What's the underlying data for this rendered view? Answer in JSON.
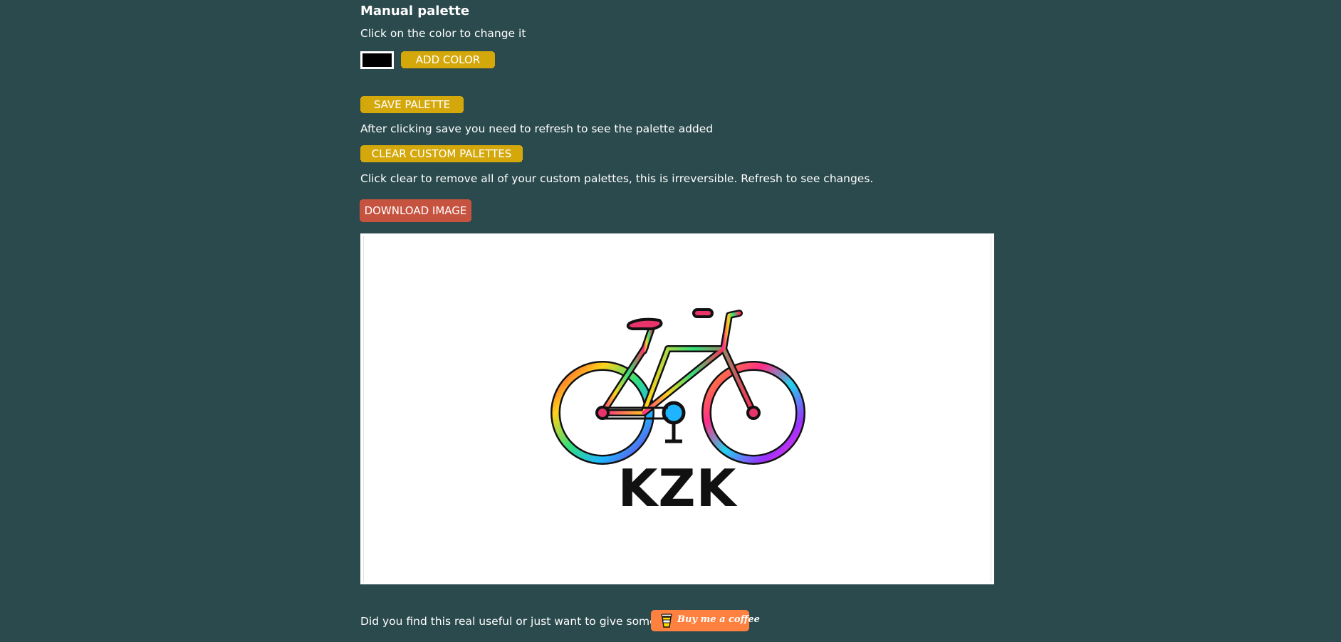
{
  "manual_palette": {
    "heading": "Manual palette",
    "hint": "Click on the color to change it",
    "swatch_color": "#000000",
    "add_color_label": "ADD COLOR"
  },
  "save": {
    "button_label": "SAVE PALETTE",
    "note": "After clicking save you need to refresh to see the palette added"
  },
  "clear": {
    "button_label": "CLEAR CUSTOM PALETTES",
    "note": "Click clear to remove all of your custom palettes, this is irreversible. Refresh to see changes."
  },
  "download": {
    "button_label": "DOWNLOAD IMAGE"
  },
  "preview": {
    "logo_text": "KZK",
    "image_subject": "rainbow bicycle"
  },
  "footer": {
    "tip_text": "Did you find this real useful or just want to give some tip?",
    "coffee_label": "Buy me a coffee"
  },
  "colors": {
    "background": "#2b4a4d",
    "button_yellow": "#d4a80b",
    "button_red": "#c65340",
    "coffee_orange": "#ff813f"
  }
}
